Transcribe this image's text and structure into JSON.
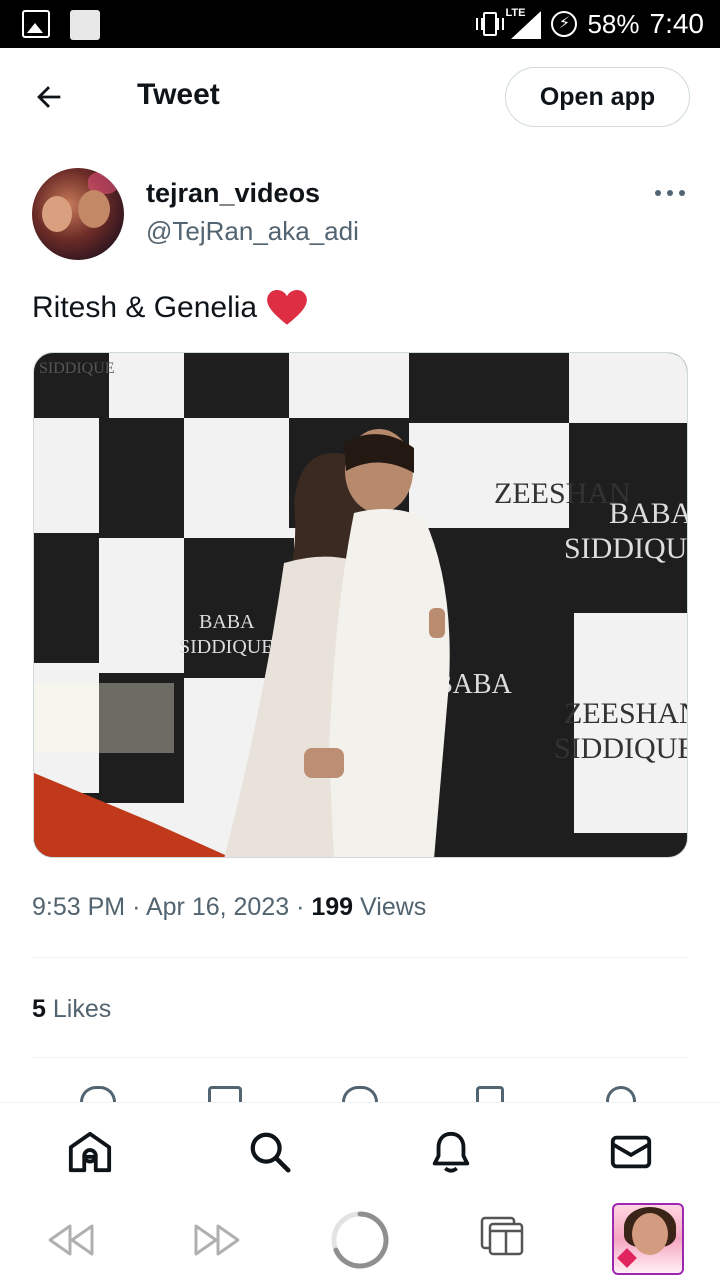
{
  "status_bar": {
    "network": "LTE",
    "battery": "58%",
    "time": "7:40"
  },
  "header": {
    "title": "Tweet",
    "open_app_label": "Open app"
  },
  "tweet": {
    "author_name": "tejran_videos",
    "author_handle": "@TejRan_aka_adi",
    "text": "Ritesh & Genelia",
    "media_texts": [
      "SIDDIQUE",
      "ZEESHAN",
      "BABA"
    ],
    "time": "9:53 PM",
    "date": "Apr 16, 2023",
    "views_count": "199",
    "views_label": "Views",
    "likes_count": "5",
    "likes_label": "Likes"
  },
  "colors": {
    "primary_text": "#0f1419",
    "secondary_text": "#536471",
    "heart": "#e0245e",
    "border": "#cfd9de"
  },
  "icons": {
    "nav": [
      "home-icon",
      "search-icon",
      "notifications-icon",
      "messages-icon"
    ],
    "actions": [
      "reply-icon",
      "retweet-icon",
      "like-icon",
      "bookmark-icon",
      "share-icon"
    ],
    "browser": [
      "rewind-icon",
      "fast-forward-icon",
      "loading-icon",
      "tabs-icon"
    ]
  }
}
